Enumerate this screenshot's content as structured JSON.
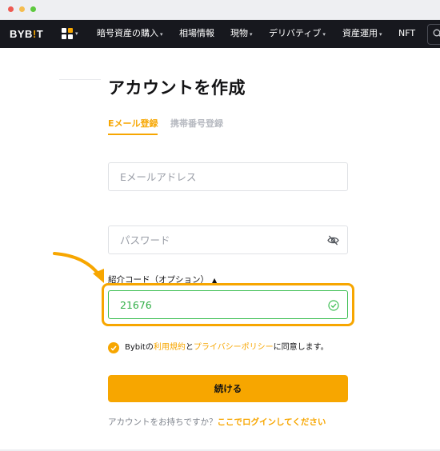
{
  "navbar": {
    "logo_main": "BYB",
    "logo_accent": "!",
    "logo_end": "T",
    "items": [
      {
        "label": "暗号資産の購入",
        "caret": "▾"
      },
      {
        "label": "相場情報",
        "caret": ""
      },
      {
        "label": "現物",
        "caret": "▾"
      },
      {
        "label": "デリバティブ",
        "caret": "▾"
      },
      {
        "label": "資産運用",
        "caret": "▾"
      },
      {
        "label": "NFT",
        "caret": ""
      }
    ],
    "apps_caret": "▾"
  },
  "form": {
    "title": "アカウントを作成",
    "tabs": [
      {
        "label": "Eメール登録",
        "active": true
      },
      {
        "label": "携帯番号登録",
        "active": false
      }
    ],
    "email": {
      "placeholder": "Eメールアドレス",
      "value": ""
    },
    "password": {
      "placeholder": "パスワード",
      "value": ""
    },
    "referral": {
      "label": "紹介コード（オプション）",
      "toggle": "▲",
      "value": "21676"
    },
    "agreement": {
      "prefix": "Bybitの",
      "terms_link": "利用規約",
      "and": "と",
      "privacy_link": "プライバシーポリシー",
      "suffix": "に同意します。",
      "checked": true
    },
    "submit_label": "続ける",
    "login_prompt": "アカウントをお持ちですか？",
    "login_link": "ここでログインしてください"
  },
  "colors": {
    "accent": "#f7a600",
    "navbar_bg": "#17181e",
    "success": "#3fbf55"
  },
  "icons": {
    "apps": "apps-grid-icon",
    "search": "search-icon",
    "eye": "eye-off-icon",
    "valid": "check-circle-icon",
    "agree": "checkmark-icon",
    "annotation": "arrow-icon"
  }
}
